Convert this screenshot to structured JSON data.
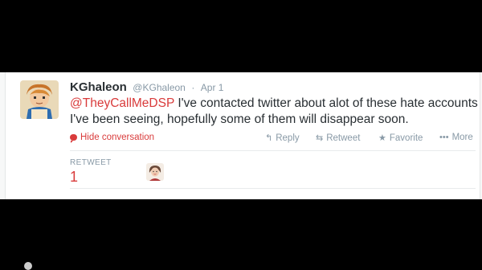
{
  "tweet": {
    "fullname": "KGhaleon",
    "handle": "@KGhaleon",
    "separator": "·",
    "date": "Apr 1",
    "mention": "@TheyCallMeDSP",
    "text": " I've contacted twitter about alot of these hate accounts I've been seeing, hopefully some of them will disappear soon."
  },
  "actions": {
    "hide_conversation": "Hide conversation",
    "reply": "Reply",
    "retweet": "Retweet",
    "favorite": "Favorite",
    "more": "More",
    "reply_icon": "↰",
    "retweet_icon": "⇆",
    "favorite_icon": "★",
    "more_icon": "•••"
  },
  "stats": {
    "label": "RETWEET",
    "count": "1"
  },
  "colors": {
    "accent": "#d93b3b",
    "text": "#292f33",
    "muted": "#8899a6"
  }
}
